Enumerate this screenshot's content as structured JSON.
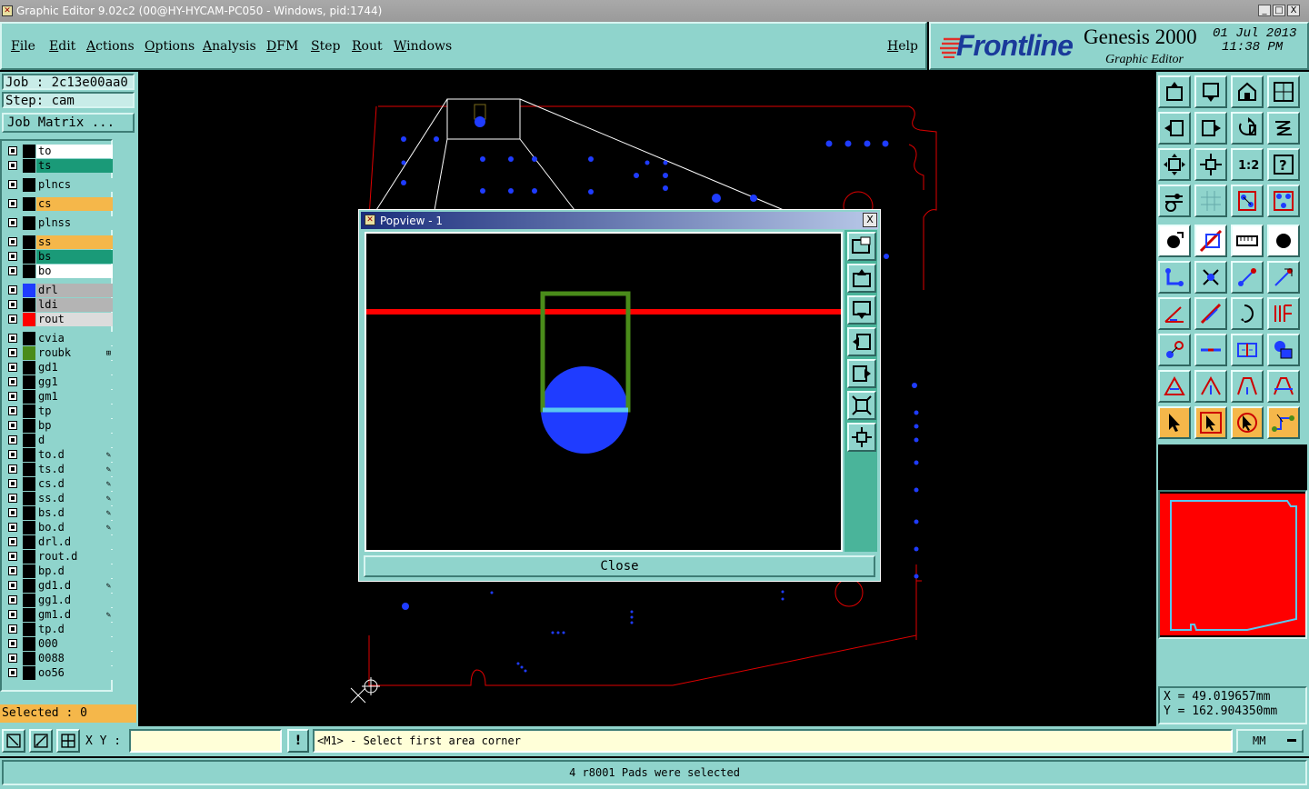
{
  "window": {
    "title": "Graphic Editor 9.02c2 (00@HY-HYCAM-PC050 - Windows, pid:1744)",
    "controls": [
      "_",
      "□",
      "X"
    ]
  },
  "menu": {
    "file": "File",
    "edit": "Edit",
    "actions": "Actions",
    "options": "Options",
    "analysis": "Analysis",
    "dfm": "DFM",
    "step": "Step",
    "rout": "Rout",
    "windows": "Windows",
    "help": "Help"
  },
  "brand": {
    "logo": "Frontline",
    "product": "Genesis 2000",
    "subtitle": "Graphic Editor",
    "date": "01 Jul 2013",
    "time": "11:38 PM"
  },
  "left_panel": {
    "job": "Job : 2c13e00aa0",
    "step": "Step: cam",
    "job_matrix": "Job Matrix ...",
    "selected": "Selected : 0",
    "layers": [
      {
        "name": "to",
        "bg": "#ffffff",
        "swatch": "#000000"
      },
      {
        "name": "ts",
        "bg": "#1a9a78",
        "swatch": "#000000"
      },
      {
        "name": "plncs",
        "bg": "#8fd4cc",
        "swatch": "#000000"
      },
      {
        "name": "cs",
        "bg": "#f5b74a",
        "swatch": "#000000"
      },
      {
        "name": "plnss",
        "bg": "#8fd4cc",
        "swatch": "#000000"
      },
      {
        "name": "ss",
        "bg": "#f5b74a",
        "swatch": "#000000"
      },
      {
        "name": "bs",
        "bg": "#1a9a78",
        "swatch": "#000000"
      },
      {
        "name": "bo",
        "bg": "#ffffff",
        "swatch": "#000000"
      },
      {
        "name": "drl",
        "bg": "#b4b4b4",
        "swatch": "#1f3cff"
      },
      {
        "name": "ldi",
        "bg": "#b4b4b4",
        "swatch": "#000000"
      },
      {
        "name": "rout",
        "bg": "#dcdcdc",
        "swatch": "#ff0000"
      },
      {
        "name": "cvia",
        "bg": "#8fd4cc",
        "swatch": "#000000"
      },
      {
        "name": "roubk",
        "bg": "#8fd4cc",
        "swatch": "#4a8c1a",
        "flag": "⊞"
      },
      {
        "name": "gd1",
        "bg": "#8fd4cc",
        "swatch": "#000000"
      },
      {
        "name": "gg1",
        "bg": "#8fd4cc",
        "swatch": "#000000"
      },
      {
        "name": "gm1",
        "bg": "#8fd4cc",
        "swatch": "#000000"
      },
      {
        "name": "tp",
        "bg": "#8fd4cc",
        "swatch": "#000000"
      },
      {
        "name": "bp",
        "bg": "#8fd4cc",
        "swatch": "#000000"
      },
      {
        "name": "d",
        "bg": "#8fd4cc",
        "swatch": "#000000"
      },
      {
        "name": "to.d",
        "bg": "#8fd4cc",
        "swatch": "#000000",
        "flag": "✎"
      },
      {
        "name": "ts.d",
        "bg": "#8fd4cc",
        "swatch": "#000000",
        "flag": "✎"
      },
      {
        "name": "cs.d",
        "bg": "#8fd4cc",
        "swatch": "#000000",
        "flag": "✎"
      },
      {
        "name": "ss.d",
        "bg": "#8fd4cc",
        "swatch": "#000000",
        "flag": "✎"
      },
      {
        "name": "bs.d",
        "bg": "#8fd4cc",
        "swatch": "#000000",
        "flag": "✎"
      },
      {
        "name": "bo.d",
        "bg": "#8fd4cc",
        "swatch": "#000000",
        "flag": "✎"
      },
      {
        "name": "drl.d",
        "bg": "#8fd4cc",
        "swatch": "#000000"
      },
      {
        "name": "rout.d",
        "bg": "#8fd4cc",
        "swatch": "#000000"
      },
      {
        "name": "bp.d",
        "bg": "#8fd4cc",
        "swatch": "#000000"
      },
      {
        "name": "gd1.d",
        "bg": "#8fd4cc",
        "swatch": "#000000",
        "flag": "✎"
      },
      {
        "name": "gg1.d",
        "bg": "#8fd4cc",
        "swatch": "#000000"
      },
      {
        "name": "gm1.d",
        "bg": "#8fd4cc",
        "swatch": "#000000",
        "flag": "✎"
      },
      {
        "name": "tp.d",
        "bg": "#8fd4cc",
        "swatch": "#000000"
      },
      {
        "name": "000",
        "bg": "#8fd4cc",
        "swatch": "#000000"
      },
      {
        "name": "0088",
        "bg": "#8fd4cc",
        "swatch": "#000000"
      },
      {
        "name": "oo56",
        "bg": "#8fd4cc",
        "swatch": "#000000"
      }
    ]
  },
  "popup": {
    "title": "Popview - 1",
    "close_label": "Close",
    "close_x": "X",
    "tools": [
      "zoom-window-icon",
      "pan-up-icon",
      "pan-down-icon",
      "pan-left-icon",
      "pan-right-icon",
      "zoom-out-icon",
      "zoom-in-icon"
    ]
  },
  "right_panel": {
    "icons": [
      "pan-up-icon",
      "pan-down-icon",
      "home-icon",
      "grid-view-icon",
      "pan-left-icon",
      "pan-right-icon",
      "rotate-icon",
      "mirror-icon",
      "zoom-fit-icon",
      "zoom-center-icon",
      "scale-1-2-icon",
      "help-icon",
      "snap-icon",
      "grid-icon",
      "measure-layers-icon",
      "compare-layers-icon",
      "add-pad-icon",
      "add-line-icon",
      "ruler-icon",
      "circle-icon",
      "connect-icon",
      "delete-node-icon",
      "move-node-icon",
      "stretch-icon",
      "angle-icon",
      "line-edit-icon",
      "arc-icon",
      "fillet-icon",
      "move-pad-icon",
      "cut-line-icon",
      "split-icon",
      "merge-icon",
      "surface-icon",
      "surface-add-icon",
      "surface-arc-icon",
      "surface-edit-icon",
      "pointer-icon",
      "select-icon",
      "select-touch-icon",
      "route-icon"
    ],
    "coord_x": "X = 49.019657mm",
    "coord_y": "Y = 162.904350mm"
  },
  "bottom_bar": {
    "xy_label": "X Y :",
    "xy_value": "",
    "exclaim": "!",
    "prompt": "<M1> - Select first area corner",
    "units": "MM"
  },
  "status": {
    "message": "4 r8001 Pads were selected"
  },
  "colors": {
    "panel": "#8fd4cc",
    "rout": "#ff0000",
    "drill": "#1f3cff",
    "roubk": "#4a8c1a",
    "highlight": "#f5b74a"
  }
}
